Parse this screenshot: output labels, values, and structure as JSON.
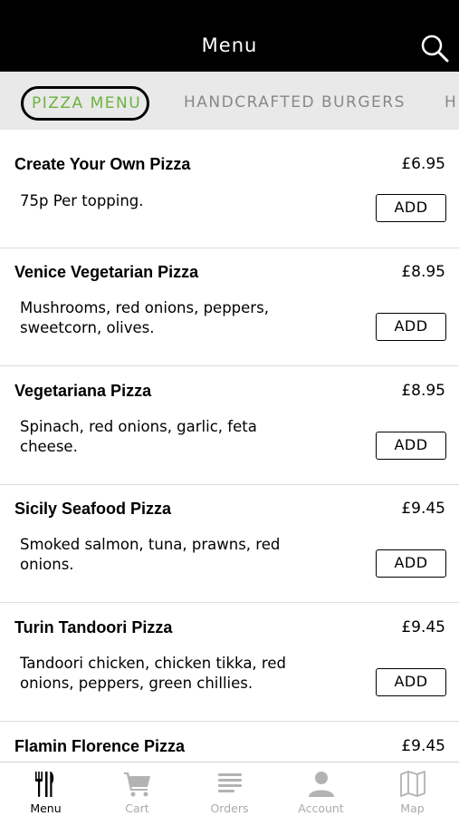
{
  "header": {
    "title": "Menu"
  },
  "categories": [
    {
      "label": "PIZZA MENU"
    },
    {
      "label": "HANDCRAFTED BURGERS"
    },
    {
      "label": "H"
    }
  ],
  "items": [
    {
      "name": "Create Your Own Pizza",
      "price": "£6.95",
      "desc": "75p Per topping.",
      "add": "ADD"
    },
    {
      "name": "Venice Vegetarian Pizza",
      "price": "£8.95",
      "desc": "Mushrooms, red onions, peppers, sweetcorn, olives.",
      "add": "ADD"
    },
    {
      "name": "Vegetariana Pizza",
      "price": "£8.95",
      "desc": "Spinach, red onions, garlic, feta cheese.",
      "add": "ADD"
    },
    {
      "name": "Sicily Seafood Pizza",
      "price": "£9.45",
      "desc": "Smoked salmon, tuna, prawns, red onions.",
      "add": "ADD"
    },
    {
      "name": "Turin Tandoori Pizza",
      "price": "£9.45",
      "desc": "Tandoori chicken, chicken tikka, red onions, peppers, green chillies.",
      "add": "ADD"
    },
    {
      "name": "Flamin Florence Pizza",
      "price": "£9.45"
    }
  ],
  "tabbar": [
    {
      "label": "Menu",
      "icon": "cutlery-icon"
    },
    {
      "label": "Cart",
      "icon": "cart-icon"
    },
    {
      "label": "Orders",
      "icon": "orders-list-icon"
    },
    {
      "label": "Account",
      "icon": "person-icon"
    },
    {
      "label": "Map",
      "icon": "map-icon"
    }
  ],
  "colors": {
    "header_bg": "#000000",
    "active_tab_text": "#6db33f",
    "inactive": "#aaaaaa"
  }
}
